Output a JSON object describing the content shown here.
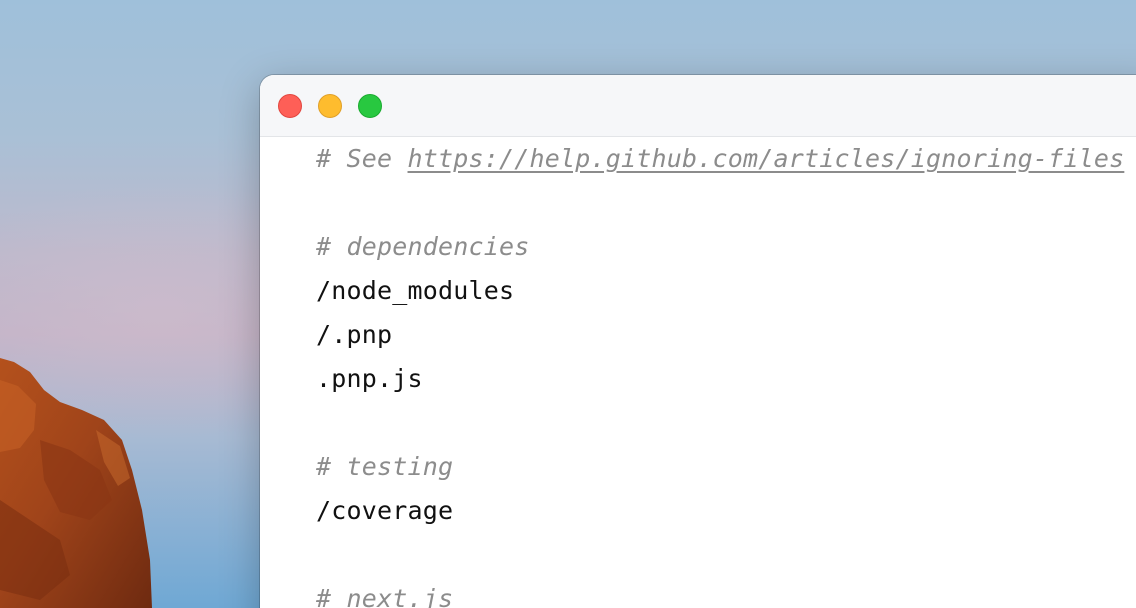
{
  "window": {
    "controls": [
      "close",
      "minimize",
      "zoom"
    ],
    "colors": {
      "close": "#fe5f57",
      "minimize": "#febc2e",
      "zoom": "#28c840"
    }
  },
  "editor": {
    "lines": [
      {
        "type": "comment",
        "prefix": "# See ",
        "url": "https://help.github.com/articles/ignoring-files"
      },
      {
        "type": "blank"
      },
      {
        "type": "comment",
        "text": "# dependencies"
      },
      {
        "type": "path",
        "text": "/node_modules"
      },
      {
        "type": "path",
        "text": "/.pnp"
      },
      {
        "type": "path",
        "text": ".pnp.js"
      },
      {
        "type": "blank"
      },
      {
        "type": "comment",
        "text": "# testing"
      },
      {
        "type": "path",
        "text": "/coverage"
      },
      {
        "type": "blank"
      },
      {
        "type": "comment",
        "text": "# next.js"
      }
    ]
  }
}
